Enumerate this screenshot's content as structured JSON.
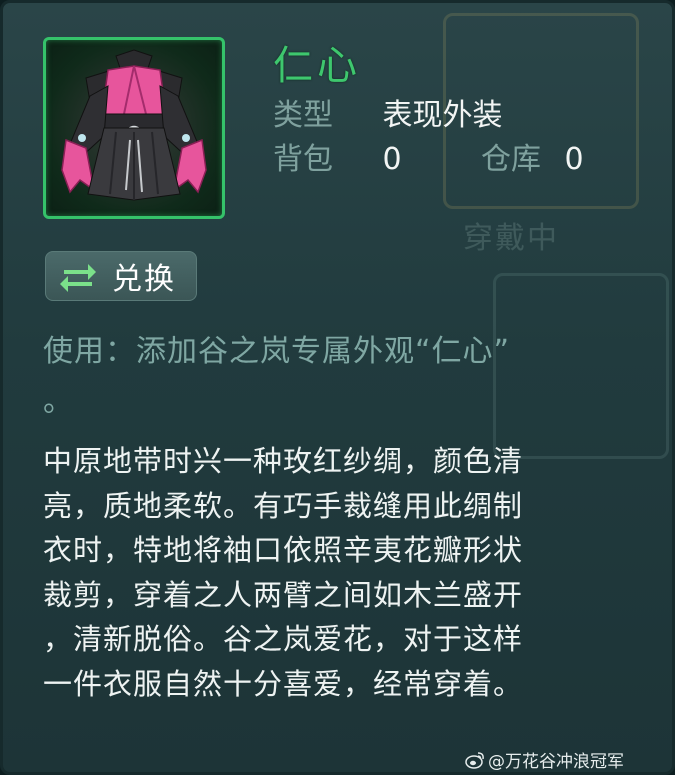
{
  "item": {
    "name": "仁心",
    "type_label": "类型",
    "type_value": "表现外装",
    "bag_label": "背包",
    "bag_value": "0",
    "warehouse_label": "仓库",
    "warehouse_value": "0",
    "icon": "pink-robe-outfit-icon",
    "rarity_color": "#35c26a"
  },
  "actions": {
    "exchange_label": "兑换",
    "exchange_icon": "swap-arrows-icon"
  },
  "usage": {
    "line1": "使用：添加谷之岚专属外观“仁心”",
    "line2": "。"
  },
  "description": {
    "lines": [
      "中原地带时兴一种玫红纱绸，颜色清",
      "亮，质地柔软。有巧手裁缝用此绸制",
      "衣时，特地将袖口依照辛夷花瓣形状",
      "裁剪，穿着之人两臂之间如木兰盛开",
      "，清新脱俗。谷之岚爱花，对于这样",
      "一件衣服自然十分喜爱，经常穿着。"
    ]
  },
  "background": {
    "ghost_text": "穿戴中"
  },
  "watermark": {
    "text": "@万花谷冲浪冠军",
    "icon": "weibo-logo-icon"
  }
}
